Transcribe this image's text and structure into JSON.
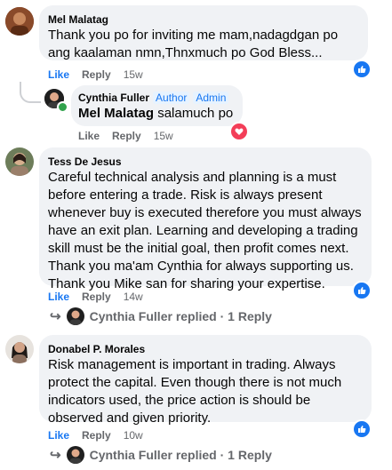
{
  "comments": [
    {
      "author": "Mel Malatag",
      "text": "Thank you po for inviting me mam,nadagdgan po ang kaalaman nmn,Thnxmuch po God Bless...",
      "like_label": "Like",
      "reply_label": "Reply",
      "time": "15w",
      "replies": [
        {
          "author": "Cynthia Fuller",
          "badges": [
            "Author",
            "Admin"
          ],
          "mention": "Mel Malatag",
          "text": " salamuch po",
          "like_label": "Like",
          "reply_label": "Reply",
          "time": "15w"
        }
      ]
    },
    {
      "author": "Tess De Jesus",
      "text": "Careful technical analysis and planning is a must before entering a trade. Risk is always present whenever buy is executed therefore you must always have an exit plan. Learning and developing a trading skill must be the initial goal, then profit comes next. Thank you ma'am Cynthia for always supporting us. Thank you Mike san for sharing your expertise.",
      "like_label": "Like",
      "reply_label": "Reply",
      "time": "14w",
      "replied_summary": "Cynthia Fuller replied · 1 Reply"
    },
    {
      "author": "Donabel P. Morales",
      "text": "Risk management is important in trading. Always protect the capital. Even though there is not much indicators used, the price action is should be observed and given priority.",
      "like_label": "Like",
      "reply_label": "Reply",
      "time": "10w",
      "replied_summary": "Cynthia Fuller replied · 1 Reply"
    }
  ],
  "colors": {
    "link_blue": "#1877f2",
    "bubble_bg": "#f0f2f5",
    "muted": "#65676b",
    "heart": "#f33e58",
    "online": "#31a24c"
  },
  "icons": {
    "like_reaction": "like-thumb-icon",
    "love_reaction": "heart-icon",
    "reply_arrow": "reply-arrow-icon"
  }
}
